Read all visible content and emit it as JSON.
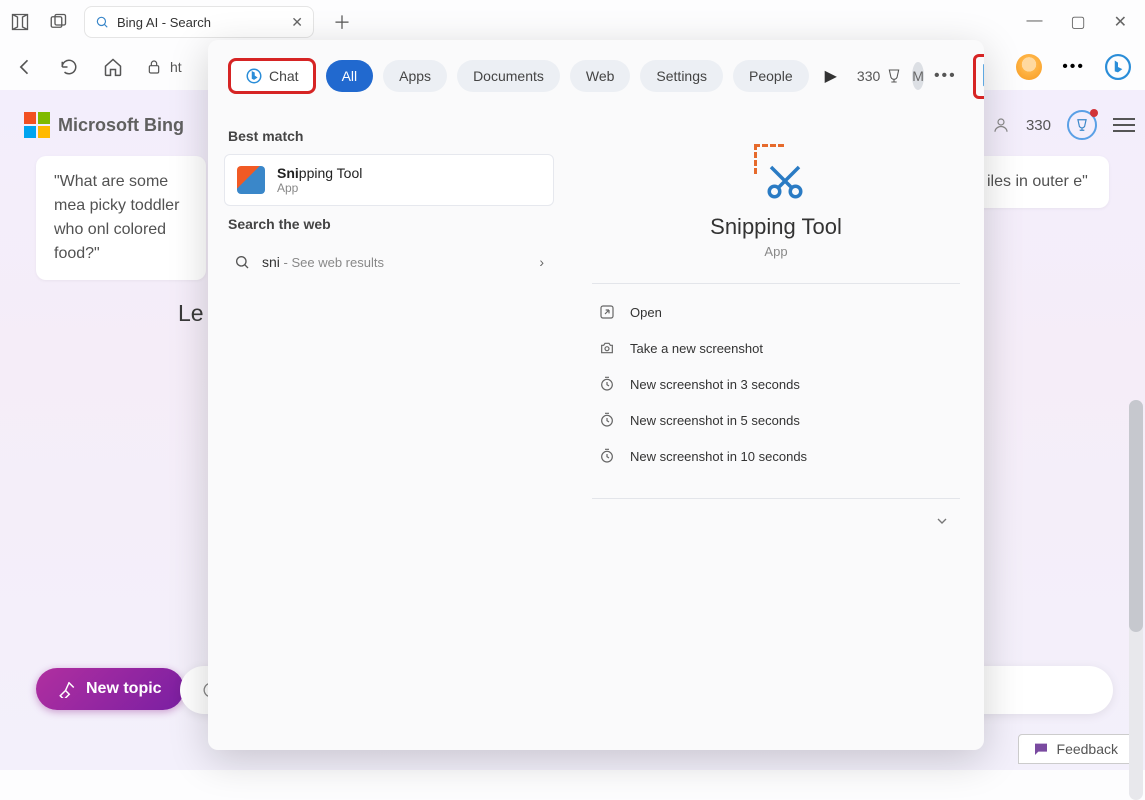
{
  "browser": {
    "tab_title": "Bing AI - Search",
    "address_fragment": "ht",
    "points": "330"
  },
  "page": {
    "brand": "Microsoft Bing",
    "card_left": "\"What are some mea picky toddler who onl colored food?\"",
    "card_right": "iles in outer e\"",
    "letters_fragment": "Le",
    "new_topic": "New topic",
    "feedback": "Feedback",
    "rewards": "330"
  },
  "search": {
    "chips": {
      "chat": "Chat",
      "all": "All",
      "apps": "Apps",
      "documents": "Documents",
      "web": "Web",
      "settings": "Settings",
      "people": "People"
    },
    "points": "330",
    "avatar_letter": "M",
    "best_match_label": "Best match",
    "best_match": {
      "name_bold": "Sni",
      "name_rest": "pping Tool",
      "sub": "App"
    },
    "search_web_label": "Search the web",
    "web_query": "sni",
    "web_hint": " - See web results",
    "detail": {
      "title": "Snipping Tool",
      "sub": "App",
      "actions": [
        "Open",
        "Take a new screenshot",
        "New screenshot in 3 seconds",
        "New screenshot in 5 seconds",
        "New screenshot in 10 seconds"
      ]
    }
  }
}
